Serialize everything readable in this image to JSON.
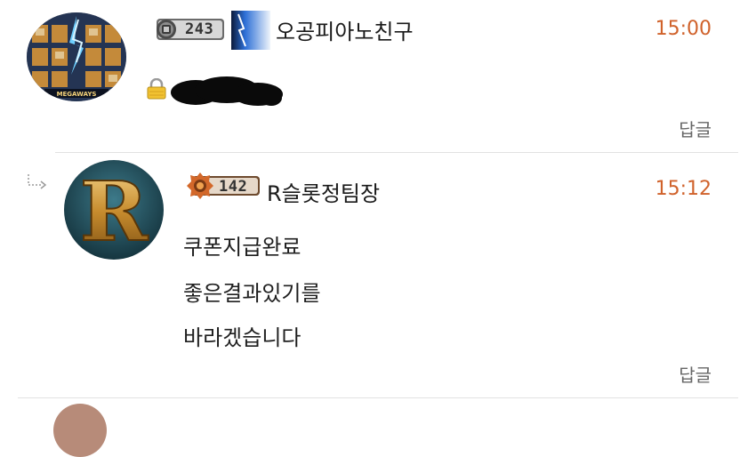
{
  "comments": [
    {
      "level": "243",
      "nickname": "오공피아노친구",
      "time": "15:00",
      "reply_label": "답글",
      "secret": true,
      "avatar_icon": "slot-game-thumbnail-icon",
      "grade_icon": "lightning-grade-icon"
    },
    {
      "level": "142",
      "nickname": "R슬롯정팀장",
      "time": "15:12",
      "reply_label": "답글",
      "is_reply": true,
      "avatar_icon": "letter-r-logo-icon",
      "body": [
        "쿠폰지급완료",
        "좋은결과있기를",
        "바라겠습니다"
      ]
    }
  ],
  "colors": {
    "time": "#d0622b",
    "reply_label": "#666666",
    "divider": "#e2e2e2"
  }
}
